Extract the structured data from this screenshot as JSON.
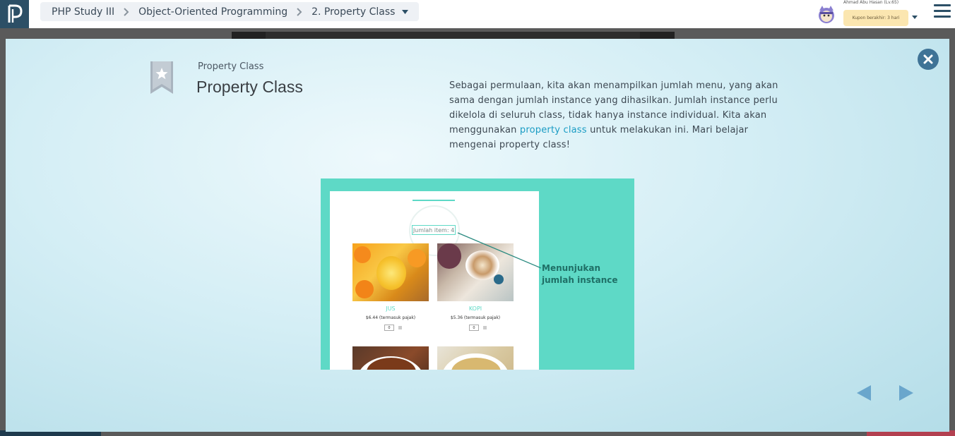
{
  "header": {
    "logo_icon": "progate-logo-icon",
    "breadcrumb": [
      "PHP Study III",
      "Object-Oriented Programming",
      "2. Property Class"
    ],
    "user": {
      "name": "Ahmad Abu Hasan (Lv.65)",
      "coupon": "Kupon berakhir: 3 hari"
    }
  },
  "modal": {
    "subtitle": "Property Class",
    "title": "Property Class",
    "description_parts": {
      "before": "Sebagai permulaan, kita akan menampilkan jumlah menu, yang akan sama dengan jumlah instance yang dihasilkan. Jumlah instance perlu dikelola di seluruh class, tidak hanya instance individual. Kita akan menggunakan ",
      "link": "property class",
      "after": " untuk melakukan ini. Mari belajar mengenai property class!"
    },
    "illustration": {
      "count_label": "Jumlah item: 4",
      "items": [
        {
          "name": "JUS",
          "price": "$6.44 (termasuk pajak)",
          "qty": "0"
        },
        {
          "name": "KOPI",
          "price": "$5.36 (termasuk pajak)",
          "qty": "0"
        }
      ],
      "callout": "Menunjukan jumlah instance"
    }
  },
  "colors": {
    "accent": "#1a9cc4",
    "teal": "#5ed9c6",
    "nav_arrow": "#6aa6cc",
    "close": "#3f7396"
  }
}
